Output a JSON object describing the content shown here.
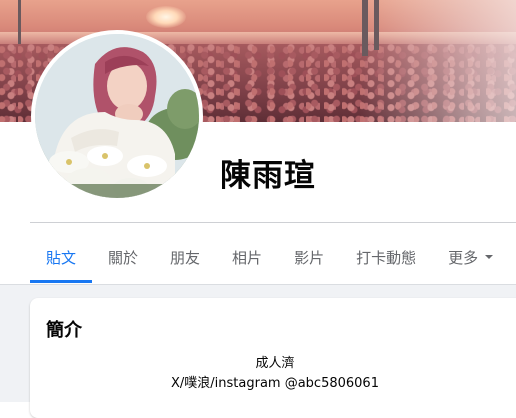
{
  "profile": {
    "name": "陳雨瑄"
  },
  "tabs": [
    {
      "label": "貼文",
      "active": true
    },
    {
      "label": "關於",
      "active": false
    },
    {
      "label": "朋友",
      "active": false
    },
    {
      "label": "相片",
      "active": false
    },
    {
      "label": "影片",
      "active": false
    },
    {
      "label": "打卡動態",
      "active": false
    },
    {
      "label": "更多",
      "active": false
    }
  ],
  "intro": {
    "title": "簡介",
    "bio_lines": [
      "成人濟",
      "X/噗浪/instagram @abc5806061"
    ]
  },
  "colors": {
    "accent": "#1877f2",
    "tab_text": "#65676b",
    "page_bg": "#f0f2f5",
    "text": "#050505"
  },
  "icons": {
    "more_tab": "caret-down-icon"
  }
}
